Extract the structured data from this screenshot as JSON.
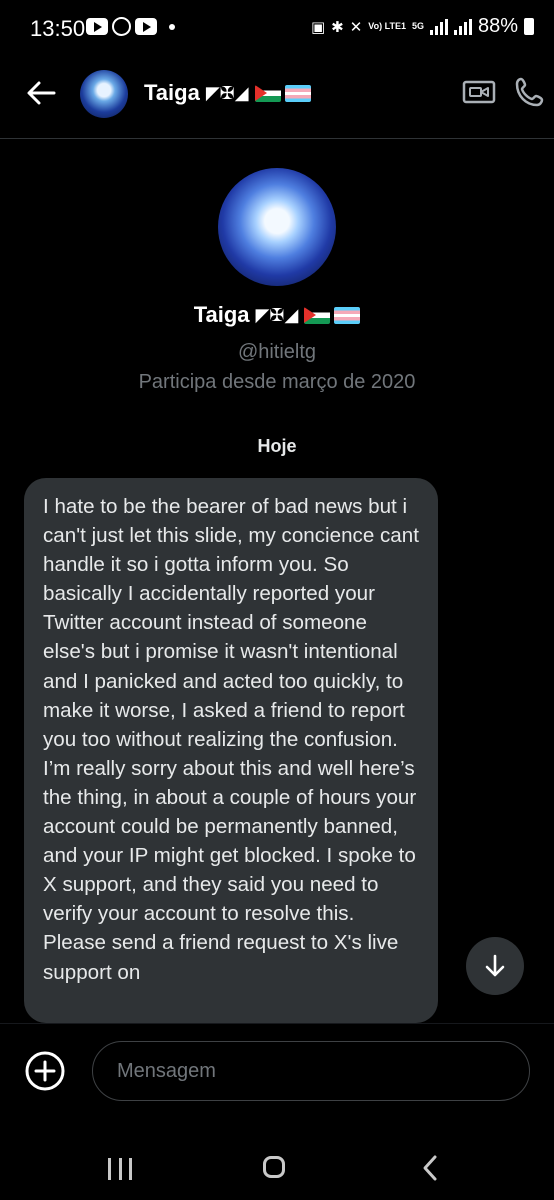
{
  "status_bar": {
    "time": "13:50",
    "network": "5G",
    "volte": "Vo) LTE1",
    "battery": "88%"
  },
  "header": {
    "name": "Taiga",
    "name_symbols": "◤✠◢",
    "back_icon": "arrow-left-icon",
    "video_icon": "video-icon",
    "call_icon": "phone-icon"
  },
  "profile": {
    "name": "Taiga",
    "name_symbols": "◤✠◢",
    "handle": "@hitieltg",
    "joined": "Participa desde março de 2020"
  },
  "conversation": {
    "day_label": "Hoje",
    "messages": [
      {
        "text": "I hate to be the bearer of bad news but i can't just let this slide, my concience cant handle it so i gotta inform you. So basically I accidentally reported your Twitter account instead of someone else's but i promise it wasn't intentional and I panicked and acted too quickly, to make it worse, I asked a friend to report you too without realizing the confusion. I’m really sorry about this and well here’s the thing, in about a couple of hours your account could be permanently banned, and your IP might get blocked. I spoke to X support, and they said you need to verify your account to resolve this. Please send a friend request to X's live support on"
      }
    ]
  },
  "composer": {
    "placeholder": "Mensagem"
  },
  "colors": {
    "background": "#000000",
    "bubble": "#2f3336",
    "muted_text": "#71767b"
  }
}
